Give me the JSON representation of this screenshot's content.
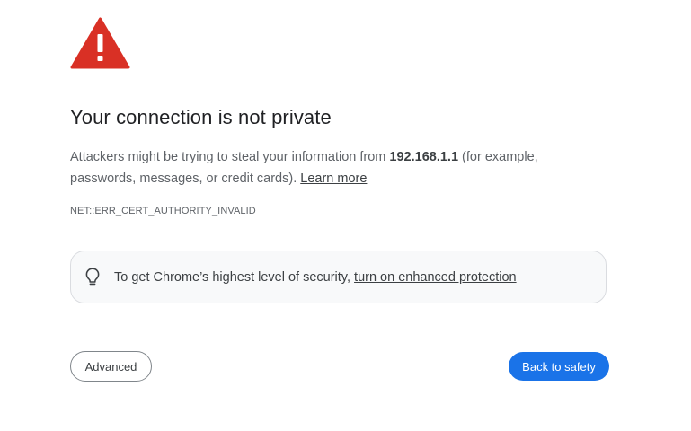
{
  "icons": {
    "warning": "warning-triangle-icon",
    "bulb": "lightbulb-icon"
  },
  "colors": {
    "warning_red": "#d93025",
    "primary_button": "#1a73e8",
    "box_background": "#f8f9fa",
    "box_border": "#dadce0"
  },
  "heading": "Your connection is not private",
  "description": {
    "before_host": "Attackers might be trying to steal your information from ",
    "host": "192.168.1.1",
    "after_host": " (for example, passwords, messages, or credit cards). ",
    "learn_more": "Learn more"
  },
  "error_code": "NET::ERR_CERT_AUTHORITY_INVALID",
  "enhanced_protection": {
    "text": "To get Chrome’s highest level of security, ",
    "link": "turn on enhanced protection"
  },
  "buttons": {
    "advanced": "Advanced",
    "back_to_safety": "Back to safety"
  }
}
